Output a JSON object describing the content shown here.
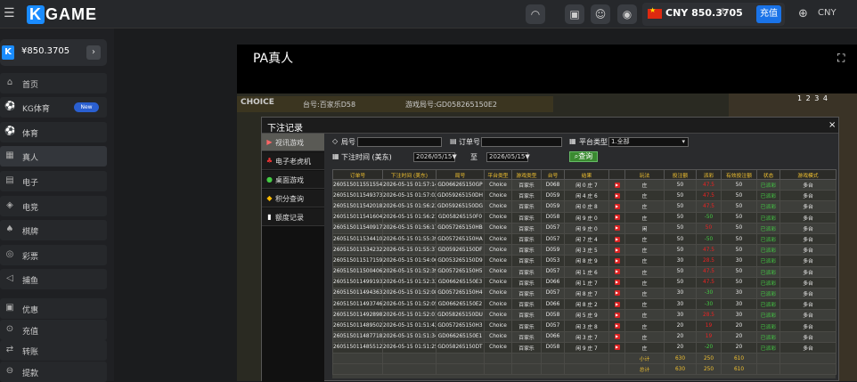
{
  "header": {
    "logo": "GAME",
    "logo_k": "K",
    "wallet_amount": "CNY 850.3705",
    "recharge": "充值",
    "currency": "CNY"
  },
  "sidebar": {
    "balance": "¥850.3705",
    "items": [
      {
        "label": "首页",
        "icon": "home-icon"
      },
      {
        "label": "KG体育",
        "icon": "sports-icon",
        "badge": "New"
      },
      {
        "label": "体育",
        "icon": "sports-icon"
      },
      {
        "label": "真人",
        "icon": "live-icon"
      },
      {
        "label": "电子",
        "icon": "slot-icon"
      },
      {
        "label": "电竞",
        "icon": "esports-icon"
      },
      {
        "label": "棋牌",
        "icon": "card-icon"
      },
      {
        "label": "彩票",
        "icon": "lottery-icon"
      },
      {
        "label": "捕鱼",
        "icon": "fish-icon"
      },
      {
        "label": "优惠",
        "icon": "gift-icon"
      },
      {
        "label": "充值",
        "icon": "deposit-icon"
      },
      {
        "label": "转账",
        "icon": "transfer-icon"
      },
      {
        "label": "提款",
        "icon": "withdraw-icon"
      }
    ]
  },
  "content": {
    "title": "PA真人",
    "game_choice": "CHOICE",
    "game_table": "台号:百家乐D58",
    "game_round": "游戏局号:GD058265150E2",
    "game_nums": "1 2 3 4"
  },
  "modal": {
    "title": "下注记录",
    "menu": [
      {
        "label": "视讯游戏",
        "icon": "video-icon"
      },
      {
        "label": "电子老虎机",
        "icon": "slot-icon"
      },
      {
        "label": "桌面游戏",
        "icon": "table-game-icon"
      },
      {
        "label": "积分查询",
        "icon": "points-icon"
      },
      {
        "label": "额度记录",
        "icon": "record-icon"
      }
    ],
    "form": {
      "round_label": "局号",
      "order_label": "订单号",
      "platform_label": "平台类型",
      "platform_value": "1.全部",
      "time_label": "下注时间 (美东)",
      "date_from": "2026/05/15▼",
      "to_label": "至",
      "date_to": "2026/05/15▼",
      "query_button": "查询"
    },
    "table": {
      "headers": [
        "订单号",
        "下注时间 (美东)",
        "局号",
        "平台类型",
        "游戏类型",
        "台号",
        "结果",
        "",
        "玩法",
        "投注额",
        "派彩",
        "有效投注额",
        "状态",
        "游戏模式"
      ],
      "rows": [
        [
          "260515011551554",
          "2026-05-15 01:57:14",
          "GD066265150GP",
          "Choice",
          "百家乐",
          "D068",
          "闲 0 庄 7",
          "庄",
          "50",
          "47.5",
          "50",
          "47.5",
          "已派彩",
          "多台"
        ],
        [
          "260515011549373",
          "2026-05-15 01:57:02",
          "GD059265150DH",
          "Choice",
          "百家乐",
          "D059",
          "闲 4 庄 6",
          "庄",
          "50",
          "47.5",
          "50",
          "47.5",
          "已派彩",
          "多台"
        ],
        [
          "260515011542018",
          "2026-05-15 01:56:23",
          "GD059265150DG",
          "Choice",
          "百家乐",
          "D059",
          "闲 0 庄 8",
          "庄",
          "50",
          "47.5",
          "50",
          "47.5",
          "已派彩",
          "多台"
        ],
        [
          "260515011541604",
          "2026-05-15 01:56:21",
          "GD058265150F0",
          "Choice",
          "百家乐",
          "D058",
          "闲 9 庄 0",
          "庄",
          "50",
          "-50",
          "50",
          "-50",
          "已派彩",
          "多台"
        ],
        [
          "260515011540917",
          "2026-05-15 01:56:17",
          "GD057265150HB",
          "Choice",
          "百家乐",
          "D057",
          "闲 9 庄 0",
          "闲",
          "50",
          "50",
          "50",
          "50",
          "已派彩",
          "多台"
        ],
        [
          "260515011534410",
          "2026-05-15 01:55:39",
          "GD057265150HA",
          "Choice",
          "百家乐",
          "D057",
          "闲 7 庄 4",
          "庄",
          "50",
          "-50",
          "50",
          "-50",
          "已派彩",
          "多台"
        ],
        [
          "260515011534232",
          "2026-05-15 01:55:37",
          "GD059265150DF",
          "Choice",
          "百家乐",
          "D059",
          "闲 3 庄 5",
          "庄",
          "50",
          "47.5",
          "50",
          "47.5",
          "已派彩",
          "多台"
        ],
        [
          "260515011517159",
          "2026-05-15 01:54:06",
          "GD053265150D9",
          "Choice",
          "百家乐",
          "D053",
          "闲 8 庄 9",
          "庄",
          "30",
          "28.5",
          "30",
          "28.5",
          "已派彩",
          "多台"
        ],
        [
          "260515011500406",
          "2026-05-15 01:52:39",
          "GD057265150H5",
          "Choice",
          "百家乐",
          "D057",
          "闲 1 庄 6",
          "庄",
          "50",
          "47.5",
          "50",
          "47.5",
          "已派彩",
          "多台"
        ],
        [
          "260515011499193",
          "2026-05-15 01:52:33",
          "GD066265150E3",
          "Choice",
          "百家乐",
          "D066",
          "闲 1 庄 7",
          "庄",
          "50",
          "47.5",
          "50",
          "47.5",
          "已派彩",
          "多台"
        ],
        [
          "260515011494363",
          "2026-05-15 01:52:08",
          "GD057265150H4",
          "Choice",
          "百家乐",
          "D057",
          "闲 8 庄 7",
          "庄",
          "30",
          "-30",
          "30",
          "-30",
          "已派彩",
          "多台"
        ],
        [
          "260515011493746",
          "2026-05-15 01:52:05",
          "GD066265150E2",
          "Choice",
          "百家乐",
          "D066",
          "闲 8 庄 2",
          "庄",
          "30",
          "-30",
          "30",
          "-30",
          "已派彩",
          "多台"
        ],
        [
          "260515011492898",
          "2026-05-15 01:52:01",
          "GD058265150DU",
          "Choice",
          "百家乐",
          "D058",
          "闲 5 庄 9",
          "庄",
          "30",
          "28.5",
          "30",
          "28.5",
          "已派彩",
          "多台"
        ],
        [
          "260515011489502",
          "2026-05-15 01:51:42",
          "GD057265150H3",
          "Choice",
          "百家乐",
          "D057",
          "闲 3 庄 8",
          "庄",
          "20",
          "19",
          "20",
          "19",
          "已派彩",
          "多台"
        ],
        [
          "260515011487718",
          "2026-05-15 01:51:34",
          "GD066265150E1",
          "Choice",
          "百家乐",
          "D066",
          "闲 3 庄 7",
          "庄",
          "20",
          "19",
          "20",
          "19",
          "已派彩",
          "多台"
        ],
        [
          "260515011485512",
          "2026-05-15 01:51:25",
          "GD058265150DT",
          "Choice",
          "百家乐",
          "D058",
          "闲 9 庄 7",
          "庄",
          "20",
          "-20",
          "20",
          "-20",
          "已派彩",
          "多台"
        ]
      ],
      "subtotal_label": "小计",
      "subtotal": [
        "630",
        "250",
        "610"
      ],
      "total_label": "总计",
      "total": [
        "630",
        "250",
        "610"
      ]
    }
  },
  "colors": {
    "accent": "#1a73e8",
    "header_text": "#f0c030",
    "win": "#44cc44",
    "loss": "#ee2222"
  }
}
